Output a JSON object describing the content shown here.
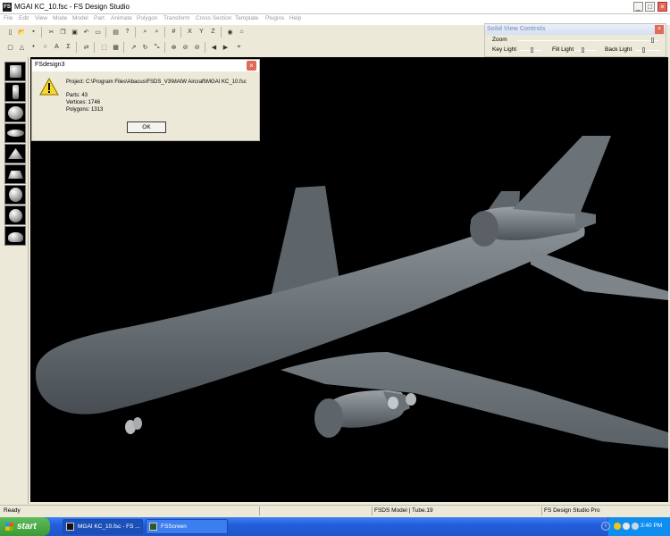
{
  "window": {
    "app_icon_text": "FS",
    "title": "MGAI KC_10.fsc - FS Design Studio"
  },
  "menu": [
    "File",
    "Edit",
    "View",
    "Mode",
    "Model",
    "Part",
    "Animate",
    "Polygon",
    "Transform",
    "Cross Section",
    "Template",
    "Plugins",
    "Help"
  ],
  "solid_view_controls": {
    "title": "Solid View Controls",
    "zoom_label": "Zoom",
    "key_light_label": "Key Light",
    "fill_light_label": "Fill Light",
    "back_light_label": "Back Light"
  },
  "dialog": {
    "title": "FSdesign3",
    "project_line": "Project: C:\\Program Files\\Abacus\\FSDS_V3\\MAIW Aircraft\\MGAI KC_10.fsc",
    "parts_line": "Parts: 43",
    "vertices_line": "Vertices: 1746",
    "polygons_line": "Polygons: 1313",
    "ok_label": "OK"
  },
  "status": {
    "left": "Ready",
    "model": "FSDS Model | Tube.19",
    "product": "FS Design Studio Pro"
  },
  "taskbar": {
    "start_label": "start",
    "task1": "MGAI KC_10.fsc - FS ...",
    "task2": "FSScreen",
    "clock": "3:40 PM"
  }
}
